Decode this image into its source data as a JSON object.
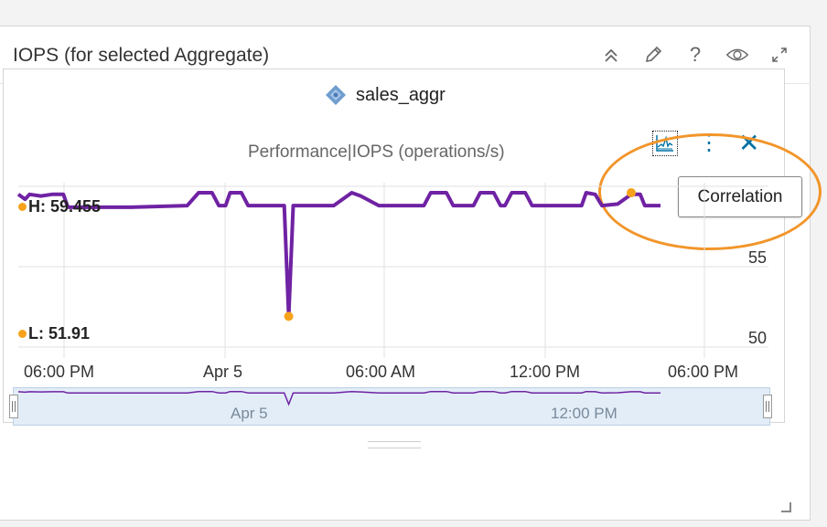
{
  "widget": {
    "title": "IOPS (for selected Aggregate)",
    "header_icons": [
      "collapse-up-icon",
      "pencil-icon",
      "help-icon",
      "eye-icon",
      "expand-icon"
    ],
    "help_label": "?"
  },
  "chart": {
    "resource_name": "sales_aggr",
    "metric_label": "Performance|IOPS (operations/s)",
    "correlation_tooltip": "Correlation",
    "high_label": "H: 59.455",
    "low_label": "L: 51.91",
    "y_ticks": [
      "55",
      "50"
    ],
    "x_ticks": [
      "06:00 PM",
      "Apr 5",
      "06:00 AM",
      "12:00 PM",
      "06:00 PM"
    ],
    "navigator_labels": [
      "Apr 5",
      "12:00 PM"
    ],
    "colors": {
      "series": "#6f22a3",
      "marker": "#f7a21b",
      "navigator": "#e2edf8",
      "accent": "#0072a3",
      "highlight": "#f2952a"
    }
  },
  "chart_data": {
    "type": "line",
    "title": "sales_aggr",
    "subtitle": "Performance|IOPS (operations/s)",
    "ylim": [
      50,
      60
    ],
    "y_ticks": [
      50,
      55
    ],
    "x_ticks": [
      "06:00 PM",
      "Apr 5",
      "06:00 AM",
      "12:00 PM",
      "06:00 PM"
    ],
    "series": [
      {
        "name": "sales_aggr",
        "points": [
          [
            0,
            59.5
          ],
          [
            0.3,
            59.2
          ],
          [
            0.5,
            59.5
          ],
          [
            1.0,
            59.4
          ],
          [
            1.5,
            59.5
          ],
          [
            2.0,
            59.5
          ],
          [
            2.2,
            58.7
          ],
          [
            5.0,
            58.7
          ],
          [
            7.5,
            58.8
          ],
          [
            8.0,
            59.6
          ],
          [
            8.6,
            59.6
          ],
          [
            8.9,
            58.8
          ],
          [
            9.2,
            58.8
          ],
          [
            9.4,
            59.6
          ],
          [
            9.9,
            59.6
          ],
          [
            10.2,
            58.8
          ],
          [
            11.8,
            58.8
          ],
          [
            12.0,
            51.91
          ],
          [
            12.2,
            58.8
          ],
          [
            14.0,
            58.8
          ],
          [
            14.8,
            59.6
          ],
          [
            15.2,
            59.4
          ],
          [
            16.0,
            58.8
          ],
          [
            18.0,
            58.8
          ],
          [
            18.3,
            59.6
          ],
          [
            19.0,
            59.6
          ],
          [
            19.3,
            58.8
          ],
          [
            20.2,
            58.8
          ],
          [
            20.5,
            59.6
          ],
          [
            21.1,
            59.6
          ],
          [
            21.4,
            58.8
          ],
          [
            21.6,
            58.8
          ],
          [
            21.9,
            59.6
          ],
          [
            22.5,
            59.6
          ],
          [
            22.8,
            58.8
          ],
          [
            25.0,
            58.8
          ],
          [
            25.2,
            59.6
          ],
          [
            25.6,
            59.5
          ],
          [
            25.9,
            58.8
          ],
          [
            26.6,
            58.9
          ],
          [
            27.2,
            59.5
          ],
          [
            27.6,
            59.5
          ],
          [
            27.8,
            58.8
          ],
          [
            28.5,
            58.8
          ]
        ]
      }
    ],
    "high": 59.455,
    "low": 51.91,
    "legend": "none",
    "grid": true
  }
}
